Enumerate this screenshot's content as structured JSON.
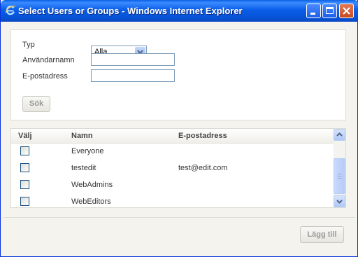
{
  "window": {
    "title": "Select Users or Groups - Windows Internet Explorer",
    "icon": "ie-icon",
    "buttons": [
      "minimize-icon",
      "maximize-icon",
      "close-icon"
    ]
  },
  "form": {
    "type_label": "Typ",
    "type_value": "Alla",
    "username_label": "Användarnamn",
    "username_value": "",
    "email_label": "E-postadress",
    "email_value": "",
    "search_button": "Sök"
  },
  "table": {
    "headers": {
      "select": "Välj",
      "name": "Namn",
      "email": "E-postadress"
    },
    "rows": [
      {
        "name": "Everyone",
        "email": ""
      },
      {
        "name": "testedit",
        "email": "test@edit.com"
      },
      {
        "name": "WebAdmins",
        "email": ""
      },
      {
        "name": "WebEditors",
        "email": ""
      }
    ]
  },
  "footer": {
    "add_button": "Lägg till"
  },
  "colors": {
    "titlebar": "#0a5fe6",
    "panel_border": "#dcdcd6",
    "disabled_text": "#999999"
  }
}
